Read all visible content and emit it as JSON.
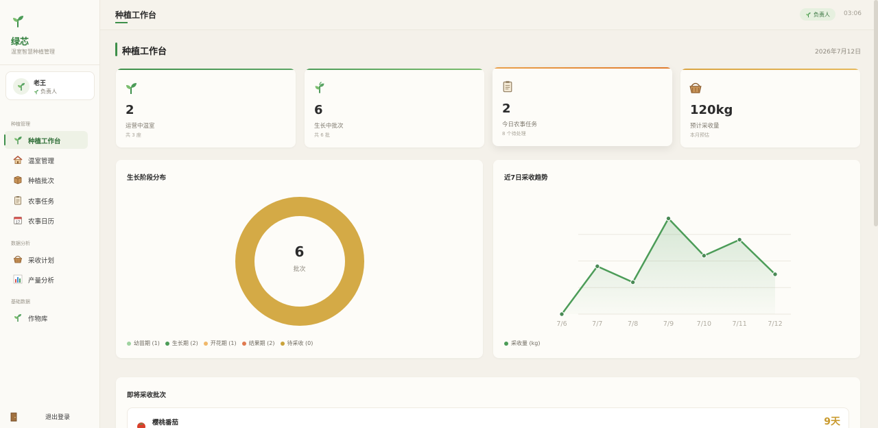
{
  "sidebar": {
    "brand_name": "绿芯",
    "brand_sub": "温室智慧种植管理",
    "user": {
      "name": "老王",
      "role": "负责人"
    },
    "sections": {
      "planting": "种植管理",
      "analysis": "数据分析",
      "base": "基础数据"
    },
    "items": [
      {
        "label": "种植工作台",
        "icon": "sprout-icon"
      },
      {
        "label": "温室管理",
        "icon": "house-icon"
      },
      {
        "label": "种植批次",
        "icon": "box-icon"
      },
      {
        "label": "农事任务",
        "icon": "clipboard-icon"
      },
      {
        "label": "农事日历",
        "icon": "calendar-icon"
      },
      {
        "label": "采收计划",
        "icon": "basket-icon"
      },
      {
        "label": "产量分析",
        "icon": "bar-chart-icon"
      },
      {
        "label": "作物库",
        "icon": "herb-icon"
      }
    ],
    "logout": "退出登录"
  },
  "topbar": {
    "title": "种植工作台",
    "role_badge": "负责人",
    "clock": "03:06"
  },
  "page": {
    "title": "种植工作台",
    "date": "2026年7月12日"
  },
  "stats": [
    {
      "value": "2",
      "label": "运营中温室",
      "sub": "共 3 座",
      "icon": "sprout-icon",
      "accent": "#3d8f4a"
    },
    {
      "value": "6",
      "label": "生长中批次",
      "sub": "共 6 批",
      "icon": "herb-icon",
      "accent": "#5aa564"
    },
    {
      "value": "2",
      "label": "今日农事任务",
      "sub": "8 个待处理",
      "icon": "clipboard-icon",
      "accent": "#e08a2c"
    },
    {
      "value": "120kg",
      "label": "预计采收量",
      "sub": "本月预估",
      "icon": "basket-icon",
      "accent": "#d9a441"
    }
  ],
  "growth_panel": {
    "title": "生长阶段分布",
    "center_value": "6",
    "center_label": "批次",
    "legend": [
      {
        "label": "幼苗期 (1)",
        "color": "#9fd3a0"
      },
      {
        "label": "生长期 (2)",
        "color": "#4c9c58"
      },
      {
        "label": "开花期 (1)",
        "color": "#f0b86a"
      },
      {
        "label": "结果期 (2)",
        "color": "#e07a50"
      },
      {
        "label": "待采收 (0)",
        "color": "#c9a23a"
      }
    ]
  },
  "trend_panel": {
    "title": "近7日采收趋势",
    "legend": "采收量 (kg)"
  },
  "upcoming": {
    "title": "即将采收批次",
    "rows": [
      {
        "name": "樱桃番茄",
        "days": "9天",
        "icon": "tomato-icon"
      }
    ]
  },
  "chart_data": {
    "type": "line",
    "x": [
      "7/6",
      "7/7",
      "7/8",
      "7/9",
      "7/10",
      "7/11",
      "7/12"
    ],
    "series": [
      {
        "name": "采收量 (kg)",
        "values": [
          0,
          18,
          12,
          36,
          22,
          28,
          15
        ]
      }
    ],
    "ylim": [
      0,
      40
    ],
    "grid": true,
    "legend_position": "bottom-left",
    "color": "#4c9c58"
  }
}
